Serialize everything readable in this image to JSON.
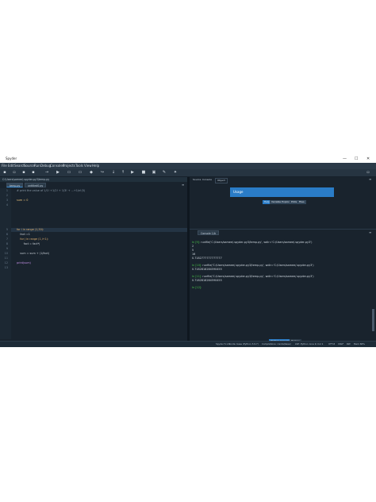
{
  "window": {
    "title": "Spyder",
    "controls": [
      "—",
      "☐",
      "✕"
    ]
  },
  "menu": [
    "File",
    "Edit",
    "Search",
    "Source",
    "Run",
    "Debug",
    "Consoles",
    "Projects",
    "Tools",
    "View",
    "Help"
  ],
  "toolbar": {
    "path": "C:\\Users\\samee\\.spyder-py3"
  },
  "editor": {
    "path_label": "C:\\Users\\samee\\.spyder-py3\\temp.py",
    "tabs": [
      "temp.py",
      "untitled0.py"
    ],
    "lines": [
      {
        "n": "1",
        "text": "# print the value of 1/1! +1/2! + 1/3! + ...+1/n!(5)"
      },
      {
        "n": "2",
        "text": ""
      },
      {
        "n": "3",
        "text": "sum = 0"
      },
      {
        "n": "4",
        "text": ""
      },
      {
        "n": "5",
        "text": "for i in range (1,30):"
      },
      {
        "n": "6",
        "text": "    fact =1"
      },
      {
        "n": "7",
        "text": "    for j in range (1,i+1):"
      },
      {
        "n": "8",
        "text": "        fact = fact*j"
      },
      {
        "n": "9",
        "text": ""
      },
      {
        "n": "10",
        "text": "    sum = sum + (1/fact)"
      },
      {
        "n": "11",
        "text": ""
      },
      {
        "n": "12",
        "text": "print(sum)"
      },
      {
        "n": "13",
        "text": ""
      }
    ]
  },
  "help": {
    "tabs": [
      "Source",
      "Console",
      "Object"
    ],
    "usage_title": "Usage",
    "buttons": [
      "Help",
      "Variable Explorer",
      "Plots",
      "Files"
    ]
  },
  "console": {
    "tab": "Console 1/A",
    "lines": [
      {
        "prompt": "In [9]: ",
        "text": "runfile('C:/Users/samee/.spyder-py3/temp.py', wdir='C:/Users/samee/.spyder-py3')"
      },
      {
        "prompt": "",
        "text": "2"
      },
      {
        "prompt": "",
        "text": "5"
      },
      {
        "prompt": "",
        "text": "16"
      },
      {
        "prompt": "",
        "text": "0.7182777777777777"
      },
      {
        "prompt": "",
        "text": ""
      },
      {
        "prompt": "In [10]: ",
        "text": "runfile('C:/Users/samee/.spyder-py3/temp.py', wdir='C:/Users/samee/.spyder-py3')"
      },
      {
        "prompt": "",
        "text": "0.7182818284590455"
      },
      {
        "prompt": "",
        "text": ""
      },
      {
        "prompt": "In [11]: ",
        "text": "runfile('C:/Users/samee/.spyder-py3/temp.py', wdir='C:/Users/samee/.spyder-py3')"
      },
      {
        "prompt": "",
        "text": "0.7182818284590455"
      },
      {
        "prompt": "",
        "text": ""
      },
      {
        "prompt": "In [12]: ",
        "text": ""
      }
    ],
    "bottom_tabs": [
      "IPython Console",
      "History"
    ]
  },
  "status": {
    "items": [
      "Spyder 5.1.5",
      "conda: base (Python 3.9.7)",
      "Completions: conda(base)",
      "LSP: Python",
      "Line 9, Col 1",
      "UTF-8",
      "CRLF",
      "RW",
      "Mem 66%"
    ]
  },
  "colors": {
    "background": "#19232d",
    "accent": "#2a7cc7",
    "prompt": "#4ac14a"
  }
}
